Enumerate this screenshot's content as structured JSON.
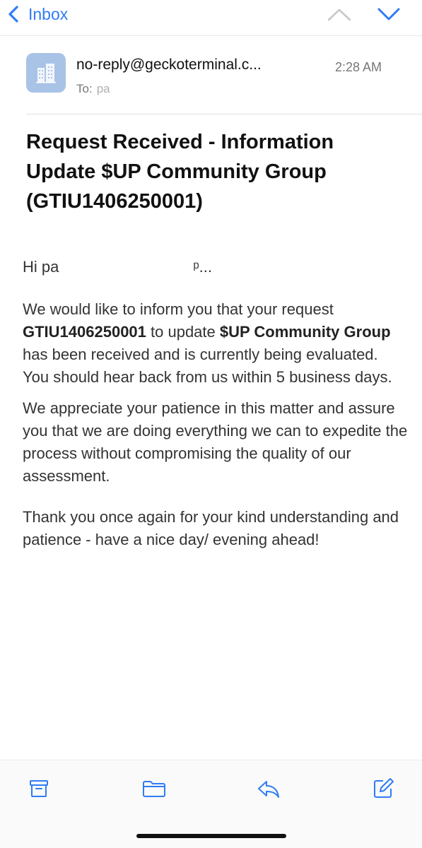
{
  "nav": {
    "back_label": "Inbox"
  },
  "message": {
    "sender": "no-reply@geckoterminal.c...",
    "time": "2:28 AM",
    "to_label": "To:",
    "to_value": "pa",
    "subject": "Request Received - Information Update $UP Community Group (GTIU1406250001)"
  },
  "body": {
    "greeting_start": "Hi pa",
    "greeting_end": "ᵖ...",
    "p1_a": "We would like to inform you that your request ",
    "p1_b": "GTIU1406250001",
    "p1_c": " to update ",
    "p1_d": "$UP Community Group",
    "p1_e": " has been received and is currently being evaluated. You should hear back from us within 5 business days.",
    "p2": "We appreciate your patience in this matter and assure you that we are doing everything we can to expedite the process without compromising the quality of our assessment.",
    "p3": "Thank you once again for your kind understanding and patience - have a nice day/ evening ahead!"
  },
  "toolbar": {
    "icons": [
      "archive-icon",
      "folder-icon",
      "reply-icon",
      "compose-icon"
    ]
  },
  "colors": {
    "accent": "#2f7cf6",
    "avatar_bg": "#a9c3e6"
  }
}
